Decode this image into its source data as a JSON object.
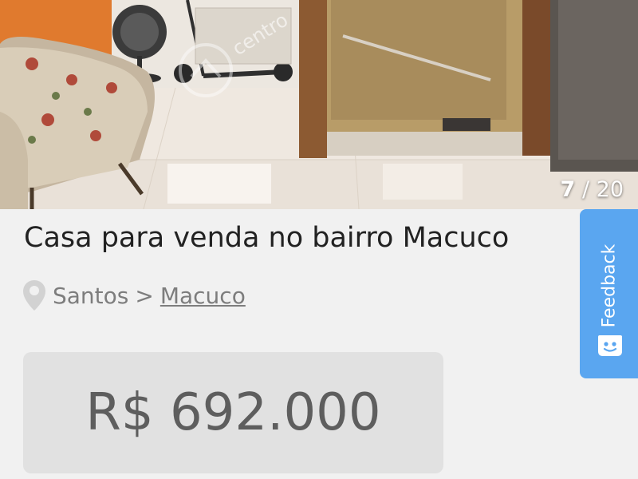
{
  "gallery": {
    "current": "7",
    "separator": "/",
    "total": "20",
    "watermark": "centro"
  },
  "listing": {
    "title": "Casa para venda no bairro Macuco",
    "city": "Santos",
    "separator": ">",
    "neighborhood": "Macuco",
    "price": "R$ 692.000"
  },
  "feedback": {
    "label": "Feedback"
  },
  "icons": {
    "location": "map-pin-icon",
    "feedback": "smiley-face-icon"
  },
  "colors": {
    "feedback_tab": "#5aa6f0",
    "price_box": "#e1e1e1",
    "title_text": "#222222",
    "muted_text": "#7d7d7d"
  }
}
